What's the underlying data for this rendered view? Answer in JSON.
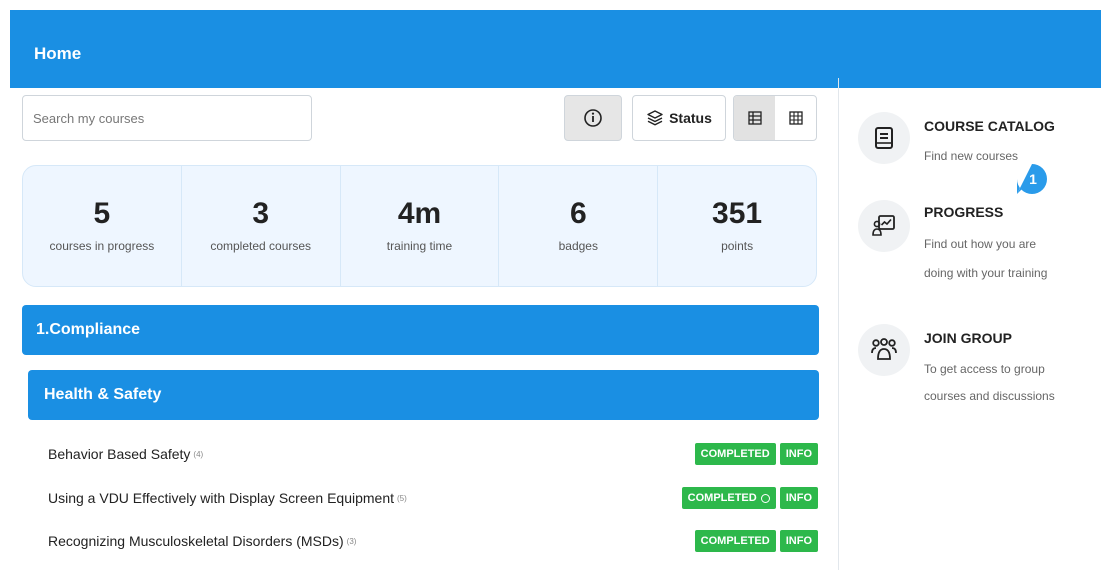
{
  "header": {
    "title": "Home"
  },
  "toolbar": {
    "search_placeholder": "Search my courses",
    "status_label": "Status"
  },
  "stats": [
    {
      "value": "5",
      "label": "courses in progress"
    },
    {
      "value": "3",
      "label": "completed courses"
    },
    {
      "value": "4m",
      "label": "training time"
    },
    {
      "value": "6",
      "label": "badges"
    },
    {
      "value": "351",
      "label": "points"
    }
  ],
  "category": {
    "title": "1.Compliance"
  },
  "subcategory": {
    "title": "Health & Safety"
  },
  "courses": [
    {
      "name": "Behavior Based Safety",
      "count": "(4)",
      "status": "COMPLETED",
      "info": "INFO"
    },
    {
      "name": "Using a VDU Effectively with Display Screen Equipment",
      "count": "(5)",
      "status": "COMPLETED",
      "info": "INFO"
    },
    {
      "name": "Recognizing Musculoskeletal Disorders (MSDs)",
      "count": "(3)",
      "status": "COMPLETED",
      "info": "INFO"
    }
  ],
  "sidebar": {
    "catalog": {
      "title": "COURSE CATALOG",
      "desc": "Find new courses"
    },
    "progress": {
      "title": "PROGRESS",
      "desc1": "Find out how you are",
      "desc2": "doing with your training",
      "pin_number": "1"
    },
    "group": {
      "title": "JOIN GROUP",
      "desc1": "To get access to group",
      "desc2": "courses and discussions"
    }
  },
  "colors": {
    "accent": "#1a8fe3",
    "success": "#2db84b"
  }
}
